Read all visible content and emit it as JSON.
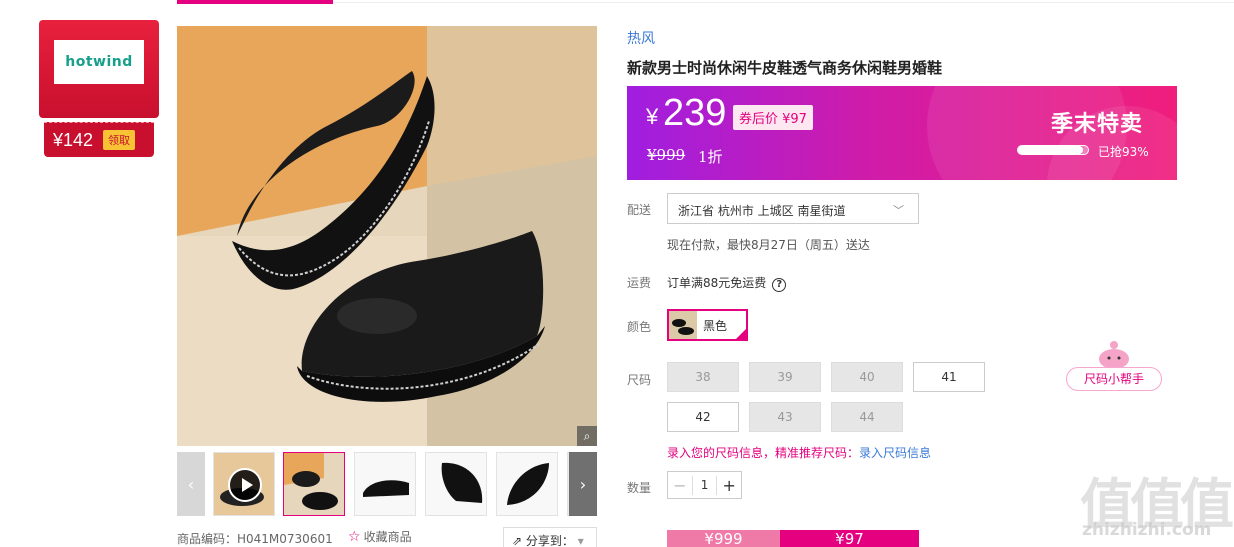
{
  "store": {
    "logo_text": "hotwind",
    "coupon_amount": "¥142",
    "coupon_action": "领取"
  },
  "product": {
    "brand": "热风",
    "title": "新款男士时尚休闲牛皮鞋透气商务休闲鞋男婚鞋",
    "code_label": "商品编码：H041M0730601",
    "favorite_label": "收藏商品",
    "share_label": "分享到："
  },
  "price": {
    "yen": "¥",
    "value": "239",
    "coupon_price": "券后价 ¥97",
    "original": "¥999",
    "discount": "1折",
    "promo_title": "季末特卖",
    "sold_fraction": 0.93,
    "sold_text": "已抢93%"
  },
  "delivery": {
    "label": "配送",
    "address": "浙江省 杭州市 上城区 南星街道",
    "eta": "现在付款，最快8月27日（周五）送达"
  },
  "shipping": {
    "label": "运费",
    "text": "订单满88元免运费",
    "help_glyph": "?"
  },
  "color": {
    "label": "颜色",
    "selected": "黑色"
  },
  "size": {
    "label": "尺码",
    "options": [
      "38",
      "39",
      "40",
      "41",
      "42",
      "43",
      "44"
    ],
    "helper_label": "尺码小帮手",
    "tip_text": "录入您的尺码信息，精准推荐尺码：",
    "tip_link": "录入尺码信息"
  },
  "quantity": {
    "label": "数量",
    "value": "1",
    "minus": "−",
    "plus": "+"
  },
  "buy": {
    "left_price": "¥999",
    "right_price": "¥97"
  },
  "watermark": {
    "glyphs": "值值值",
    "site": "zhizhizhi.com"
  },
  "colors": {
    "accent": "#e4007f",
    "link": "#3b7ad8",
    "store_red": "#c8102e"
  }
}
